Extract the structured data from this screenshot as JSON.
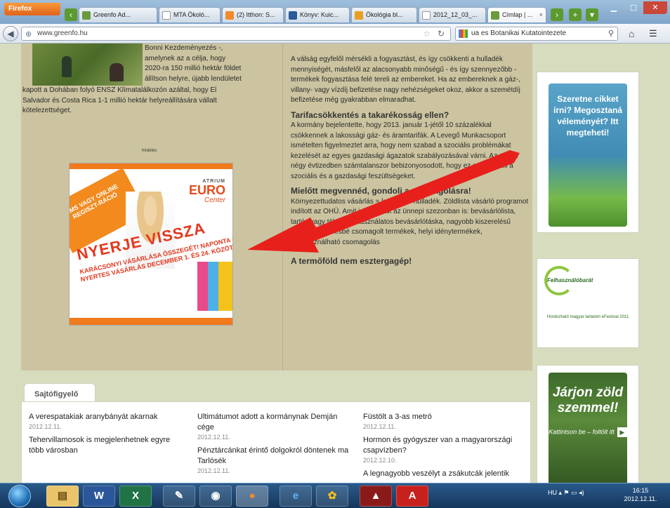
{
  "browser": {
    "firefox_button": "Firefox",
    "tabs": [
      {
        "label": "Greenfo Ad...",
        "active": false
      },
      {
        "label": "MTA Ökoló...",
        "active": false
      },
      {
        "label": "(2) Itthon: S...",
        "active": false
      },
      {
        "label": "Könyv: Kuic...",
        "active": false
      },
      {
        "label": "Ökológia bl...",
        "active": false
      },
      {
        "label": "2012_12_03_...",
        "active": false
      },
      {
        "label": "Címlap | ...",
        "active": true
      }
    ],
    "url": "www.greenfo.hu",
    "search_text": "ua es Botanikai Kutatointezete"
  },
  "main": {
    "lead_text_right_of_photo": [
      "Bonni Kezdeményezés -,",
      "amelynek az a célja, hogy",
      "2020-ra 150 millió hektár földet",
      "állítson helyre, újabb lendületet"
    ],
    "lead_text_full": [
      "kapott a Dohában folyó ENSZ Klímatalálkozón azáltal, hogy El",
      "Salvador és Costa Rica 1-1 millió hektár helyreállítására vállalt",
      "kötelezettséget."
    ],
    "advert_label": "hirdetés",
    "ad": {
      "badge": "SMS VAGY ONLINE REGISZT-RÁCIÓ",
      "logo_small": "ATRIUM",
      "logo_big": "EURO",
      "logo_script": "Center",
      "headline": "NYERJE VISSZA",
      "subline": "KARÁCSONYI VÁSÁRLÁSA ÖSSZEGÉT! NAPONTA 3 NYERTES VÁSÁRLÁS DECEMBER 1. ÉS 24. KÖZÖTT."
    },
    "articles": [
      {
        "title": "",
        "body": "A válság egyfelől mérsékli a fogyasztást, és így csökkenti a hulladék mennyiségét, másfelől az alacsonyabb minőségű - és így szennyezőbb - termékek fogyasztása felé tereli az embereket. Ha az embereknek a gáz-, villany- vagy vízdíj befizetése nagy nehézségeket okoz, akkor a szemétdíj befizetése még gyakrabban elmaradhat."
      },
      {
        "title": "Tarifacsökkentés a takarékosság ellen?",
        "body": "A kormány bejelentette, hogy 2013. január 1-jétől 10 százalékkal csökkennek a lakossági gáz- és áramtarifák. A Levegő Munkacsoport ismételten figyelmeztet arra, hogy nem szabad a szociális problémákat kezelését az egyes gazdasági ágazatok szabályozásával várni. Az elmúlt négy évtizedben számtalanszor bebizonyosodott, hogy ez csak növeli a szociális és a gazdasági feszültségeket."
      },
      {
        "title": "Mielőtt megvennéd, gondolj a csomagolásra!",
        "body": "Környezettudatos vásárlás = kevesebb hulladék. Zöldlista vásárló programot indított az OHÜ. Amit javasolnak az ünnepi szezonban is: bevásárlólista, tartós vagy többször használatos bevásárlótáska, nagyobb kiszerelésű termékek, kevésbé csomagolt termékek, helyi idénytermékek, újrahasználható csomagolás"
      },
      {
        "title": "A termőföld nem esztergagép!",
        "body": ""
      }
    ]
  },
  "sidebar": {
    "szeretne": "Szeretne cikket írni? Megosztaná véleményét? Itt megteheti!",
    "foglal_title": "Felhasználóbarát",
    "foglal_sub": "Hordozható magyar tartalom eFestival 2011",
    "jarjon_main": "Járjon zöld szemmel!",
    "jarjon_sub": "Kattintson be – foltölt itt"
  },
  "sajto": {
    "tab_label": "Sajtófigyelő",
    "columns": [
      [
        {
          "title": "A verespatakiak aranybányát akarnak",
          "date": "2012.12.11."
        },
        {
          "title": "Tehervillamosok is megjelenhetnek egyre több városban",
          "date": ""
        }
      ],
      [
        {
          "title": "Ultimátumot adott a kormánynak Demján cége",
          "date": "2012.12.11."
        },
        {
          "title": "Pénztárcánkat érintő dolgokról döntenek ma Tarlósék",
          "date": "2012.12.11."
        }
      ],
      [
        {
          "title": "Füstölt a 3-as metró",
          "date": "2012.12.11."
        },
        {
          "title": "Hormon és gyógyszer van a magyarországi csapvízben?",
          "date": "2012.12.10."
        },
        {
          "title": "A legnagyobb veszélyt a zsákutcák jelentik",
          "date": ""
        }
      ]
    ]
  },
  "taskbar": {
    "lang": "HU",
    "time": "16:15",
    "date": "2012.12.11."
  }
}
